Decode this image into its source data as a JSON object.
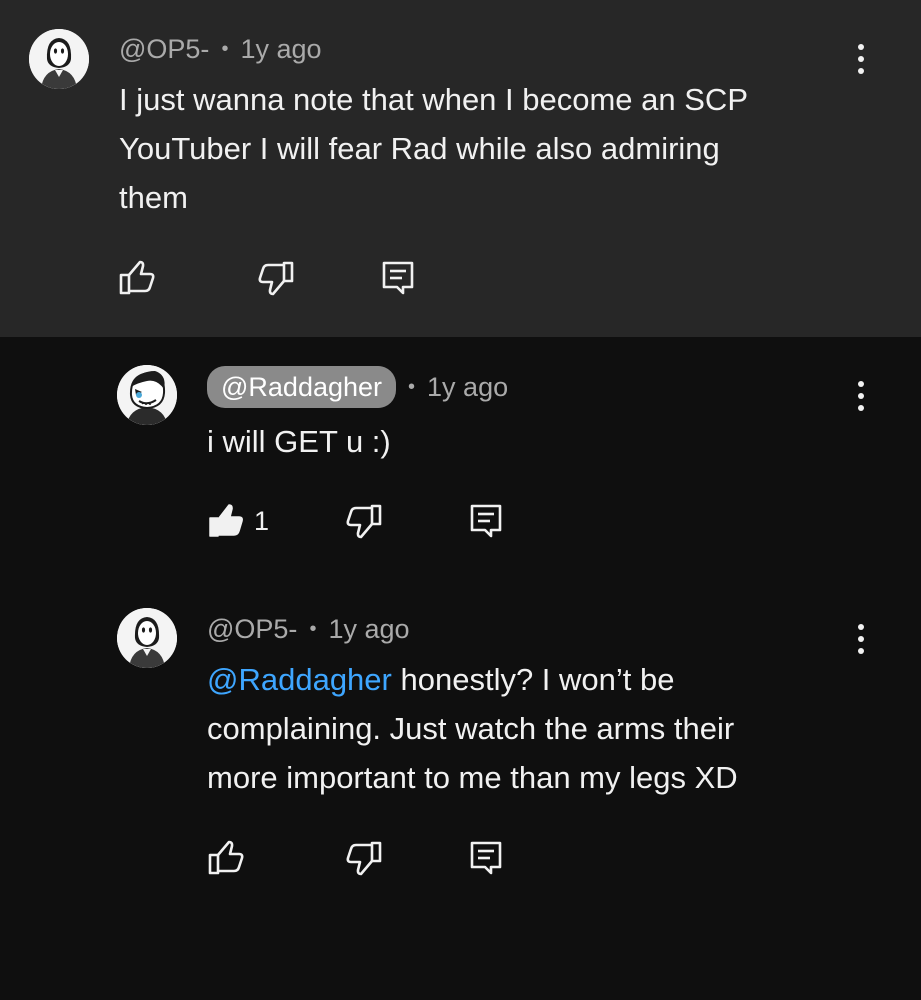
{
  "comments": [
    {
      "author": "@OP5-",
      "time": "1y ago",
      "lines": [
        "I just wanna note that when I become an SCP",
        "YouTuber I will fear Rad while also admiring",
        "them"
      ],
      "avatar_icon": "masked-figure-avatar",
      "like_count": ""
    },
    {
      "author": "@Raddagher",
      "time": "1y ago",
      "lines": [
        "i will GET u :)"
      ],
      "avatar_icon": "grinning-character-avatar",
      "like_count": "1",
      "liked": true
    },
    {
      "author": "@OP5-",
      "time": "1y ago",
      "mention": "@Raddagher",
      "lines": [
        " honestly? I won’t be",
        "complaining. Just watch the arms their",
        "more important to me than my legs XD"
      ],
      "avatar_icon": "masked-figure-avatar",
      "like_count": ""
    }
  ],
  "colors": {
    "highlight_bg": "#272727",
    "page_bg": "#0f0f0f",
    "mention": "#3ea6ff",
    "meta": "#aaaaaa",
    "pill_bg": "#8a8a8a"
  },
  "icons": {
    "like": "thumbs-up-icon",
    "dislike": "thumbs-down-icon",
    "reply": "reply-comment-icon",
    "more": "more-vertical-icon"
  }
}
